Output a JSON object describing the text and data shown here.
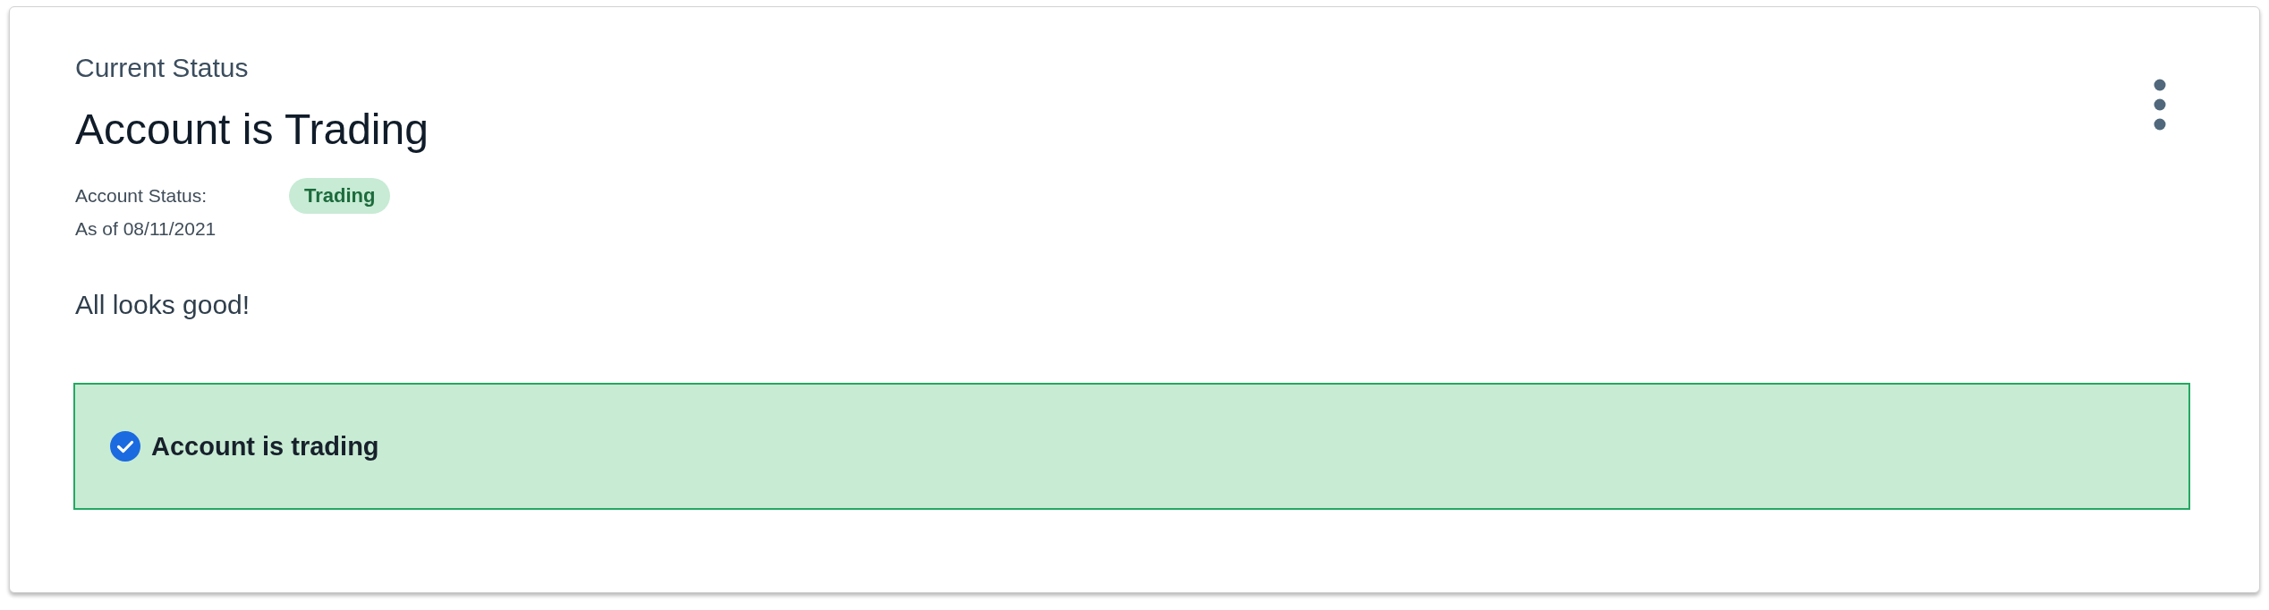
{
  "card": {
    "eyebrow": "Current Status",
    "title": "Account is Trading",
    "status": {
      "label": "Account Status:",
      "badge": {
        "text": "Trading",
        "kind": "success"
      },
      "as_of": "As of 08/11/2021"
    },
    "message": "All looks good!",
    "alert": {
      "kind": "success",
      "text": "Account is trading"
    }
  }
}
